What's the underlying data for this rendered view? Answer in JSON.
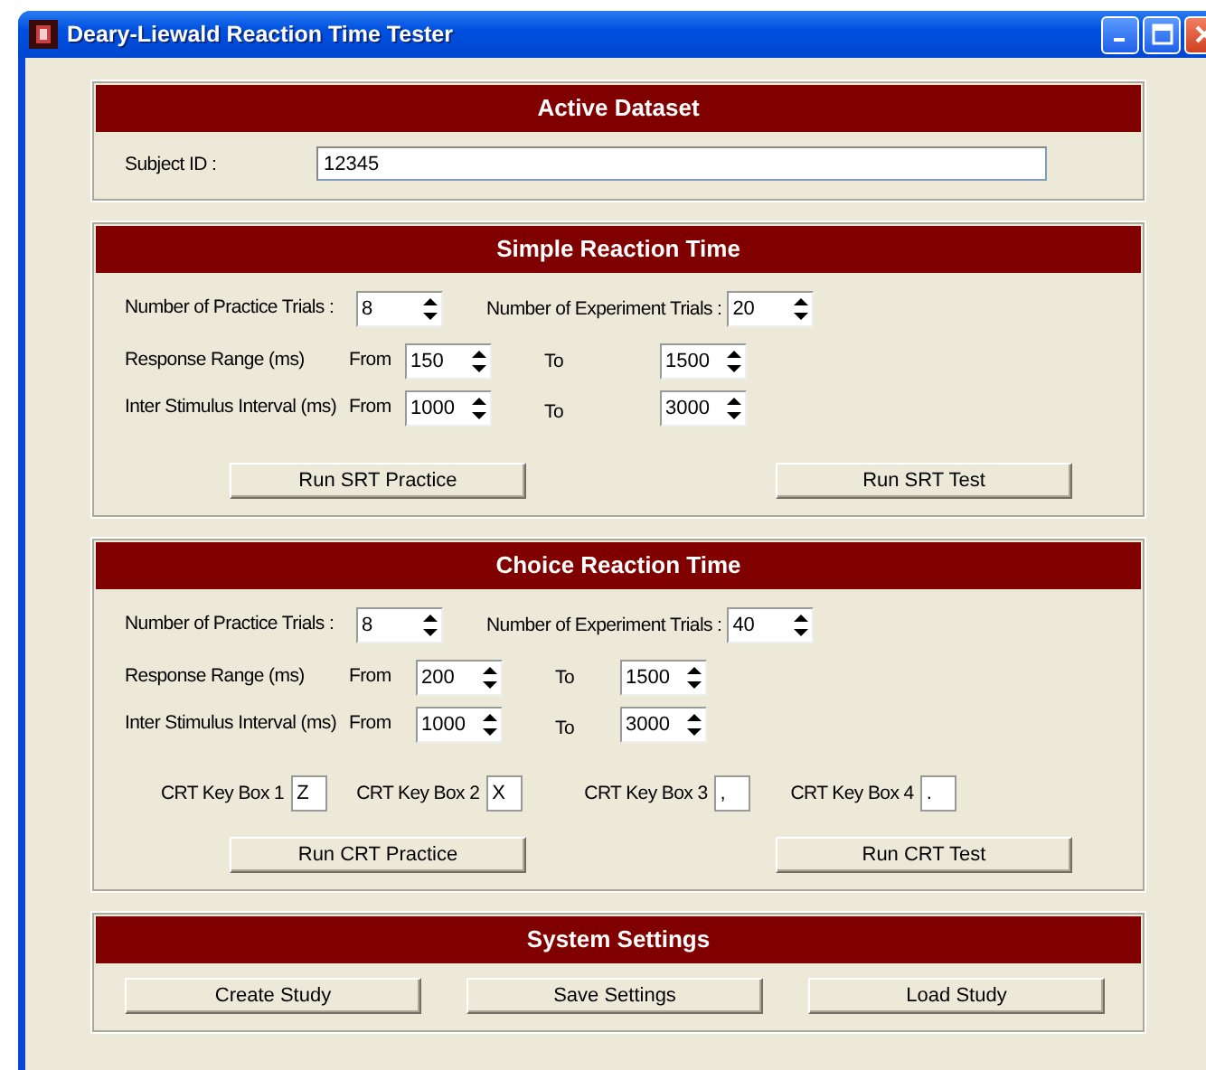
{
  "window": {
    "title": "Deary-Liewald Reaction Time Tester"
  },
  "active_dataset": {
    "title": "Active Dataset",
    "subject_id": {
      "label": "Subject ID :",
      "value": "12345"
    }
  },
  "simple": {
    "title": "Simple Reaction Time",
    "practice_trials": {
      "label": "Number of Practice Trials :",
      "value": "8"
    },
    "experiment_trials": {
      "label": "Number of Experiment Trials :",
      "value": "20"
    },
    "ranges": [
      {
        "label": "Response Range (ms)",
        "from_label": "From",
        "from": "150",
        "to_label": "To",
        "to": "1500"
      },
      {
        "label": "Inter Stimulus Interval (ms)",
        "from_label": "From",
        "from": "1000",
        "to_label": "To",
        "to": "3000"
      }
    ],
    "buttons": [
      "Run SRT Practice",
      "Run SRT Test"
    ]
  },
  "choice": {
    "title": "Choice Reaction Time",
    "practice_trials": {
      "label": "Number of Practice Trials :",
      "value": "8"
    },
    "experiment_trials": {
      "label": "Number of Experiment Trials :",
      "value": "40"
    },
    "ranges": [
      {
        "label": "Response Range (ms)",
        "from_label": "From",
        "from": "200",
        "to_label": "To",
        "to": "1500"
      },
      {
        "label": "Inter Stimulus Interval (ms)",
        "from_label": "From",
        "from": "1000",
        "to_label": "To",
        "to": "3000"
      }
    ],
    "key_boxes": [
      {
        "label": "CRT Key Box 1",
        "value": "Z"
      },
      {
        "label": "CRT Key Box 2",
        "value": "X"
      },
      {
        "label": "CRT Key Box 3",
        "value": ","
      },
      {
        "label": "CRT Key Box 4",
        "value": "."
      }
    ],
    "buttons": [
      "Run CRT Practice",
      "Run CRT Test"
    ]
  },
  "system": {
    "title": "System Settings",
    "buttons": [
      "Create Study",
      "Save Settings",
      "Load Study"
    ]
  }
}
